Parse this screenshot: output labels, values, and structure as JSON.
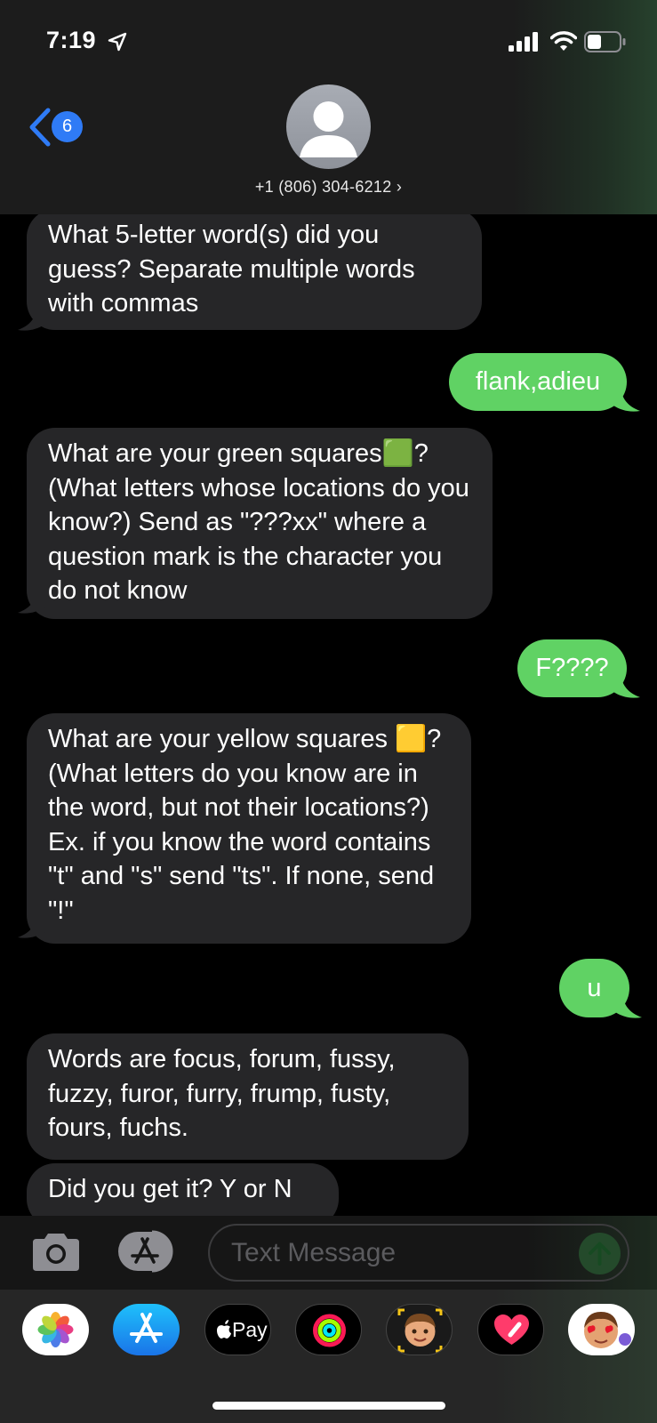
{
  "status_bar": {
    "time": "7:19"
  },
  "header": {
    "back_count": "6",
    "contact": "+1 (806) 304-6212 ›"
  },
  "messages": [
    {
      "from": "them",
      "text": "What 5-letter word(s) did you guess? Separate multiple words with commas"
    },
    {
      "from": "me",
      "text": "flank,adieu"
    },
    {
      "from": "them",
      "text": "What are your green squares🟩? (What letters whose locations do you know?) Send as \"???xx\" where a question mark is the character you do not know"
    },
    {
      "from": "me",
      "text": "F????"
    },
    {
      "from": "them",
      "text": "What are your yellow squares 🟨? (What letters do you know are in the word, but not their locations?) Ex. if you know the word contains \"t\" and \"s\" send \"ts\". If none, send \"!\""
    },
    {
      "from": "me",
      "text": "u"
    },
    {
      "from": "them",
      "text": "Words are focus, forum, fussy, fuzzy, furor, furry, frump, fusty, fours, fuchs."
    },
    {
      "from": "them",
      "text": "Did you get it? Y or N"
    }
  ],
  "input": {
    "placeholder": "Text Message"
  },
  "app_drawer": {
    "apple_pay_label": "Pay"
  },
  "colors": {
    "incoming": "#262628",
    "outgoing": "#60d264",
    "badge": "#2f7bf6"
  }
}
